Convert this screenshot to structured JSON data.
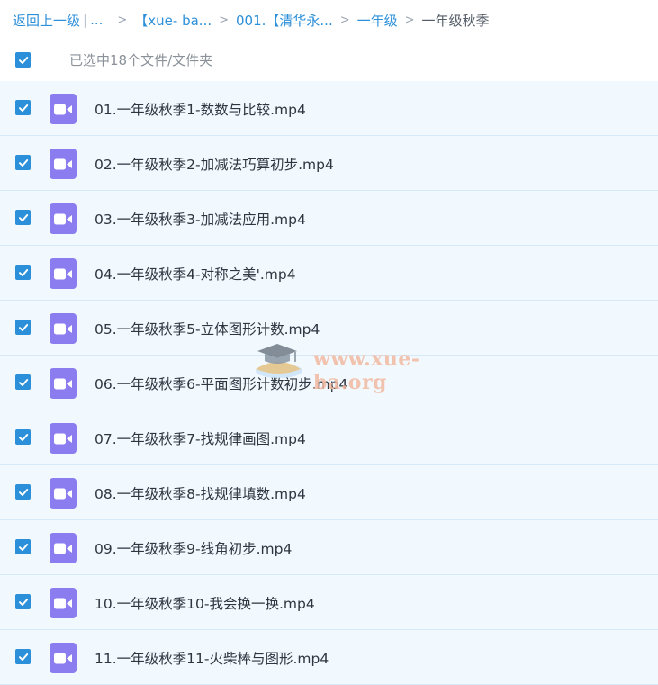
{
  "breadcrumb": {
    "back_label": "返回上一级",
    "separator": "|",
    "ellipsis": "...",
    "arrow": ">",
    "items": [
      {
        "label": "【xue- ba..."
      },
      {
        "label": "001.【清华永..."
      },
      {
        "label": "一年级"
      }
    ],
    "current": "一年级秋季"
  },
  "selection": {
    "text": "已选中18个文件/文件夹",
    "all_checked": true
  },
  "icons": {
    "checkbox": "checkbox-checked-icon",
    "file": "video-file-icon"
  },
  "colors": {
    "accent": "#2b8fd9",
    "row_background": "#f1f8fe",
    "video_icon": "#8b7cf0"
  },
  "files": [
    {
      "name": "01.一年级秋季1-数数与比较.mp4",
      "checked": true
    },
    {
      "name": "02.一年级秋季2-加减法巧算初步.mp4",
      "checked": true
    },
    {
      "name": "03.一年级秋季3-加减法应用.mp4",
      "checked": true
    },
    {
      "name": "04.一年级秋季4-对称之美'.mp4",
      "checked": true
    },
    {
      "name": "05.一年级秋季5-立体图形计数.mp4",
      "checked": true
    },
    {
      "name": "06.一年级秋季6-平面图形计数初步.mp4",
      "checked": true
    },
    {
      "name": "07.一年级秋季7-找规律画图.mp4",
      "checked": true
    },
    {
      "name": "08.一年级秋季8-找规律填数.mp4",
      "checked": true
    },
    {
      "name": "09.一年级秋季9-线角初步.mp4",
      "checked": true
    },
    {
      "name": "10.一年级秋季10-我会换一换.mp4",
      "checked": true
    },
    {
      "name": "11.一年级秋季11-火柴棒与图形.mp4",
      "checked": true
    }
  ],
  "watermark": {
    "text": "www.xue-ba.org"
  }
}
